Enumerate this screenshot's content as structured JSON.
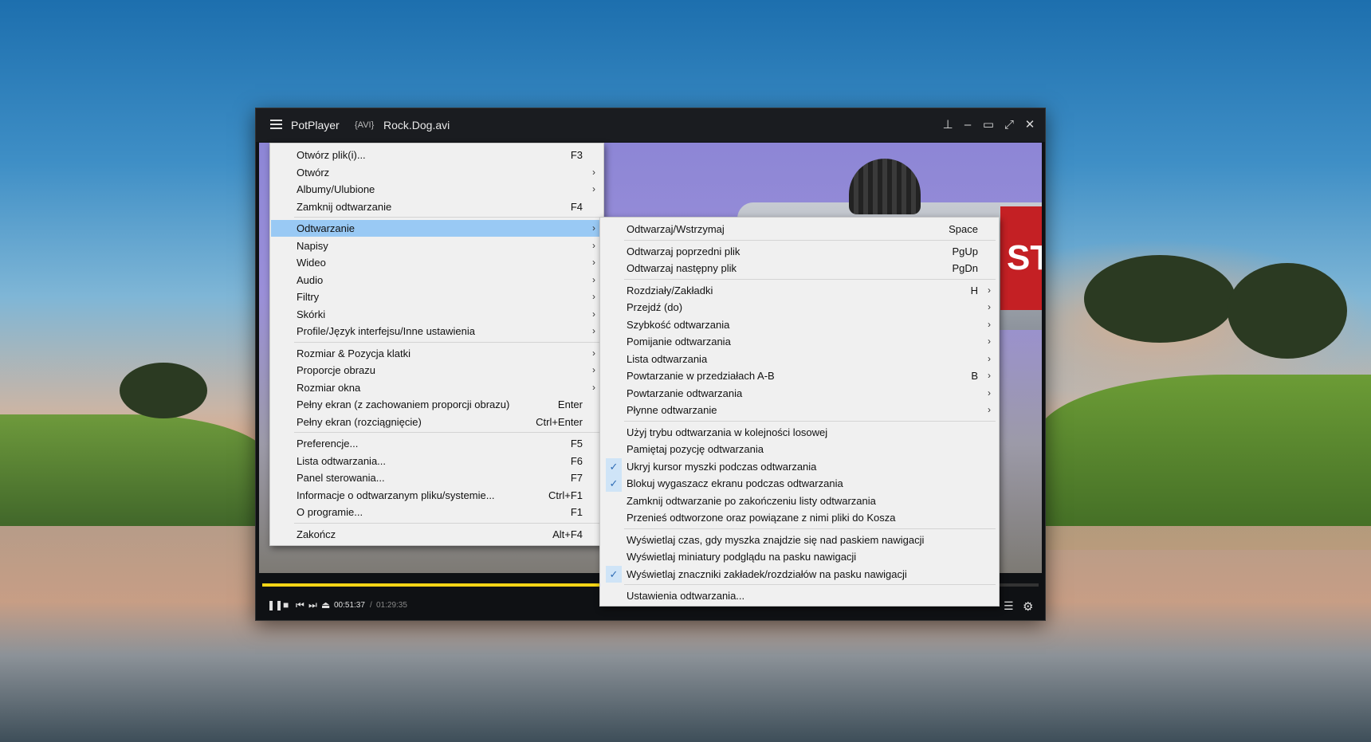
{
  "window": {
    "app_title": "PotPlayer",
    "format_tag": "{AVI}",
    "file_name": "Rock.Dog.avi"
  },
  "video_text": {
    "stop": "STO"
  },
  "playback": {
    "time_current": "00:51:37",
    "time_separator": "/",
    "time_total": "01:29:35",
    "progress_fraction": 0.576
  },
  "main_menu": {
    "items": [
      {
        "label": "Otwórz plik(i)...",
        "shortcut": "F3",
        "submenu": false
      },
      {
        "label": "Otwórz",
        "shortcut": "",
        "submenu": true
      },
      {
        "label": "Albumy/Ulubione",
        "shortcut": "",
        "submenu": true
      },
      {
        "label": "Zamknij odtwarzanie",
        "shortcut": "F4",
        "submenu": false
      },
      {
        "label": "Odtwarzanie",
        "shortcut": "",
        "submenu": true,
        "active": true
      },
      {
        "label": "Napisy",
        "shortcut": "",
        "submenu": true
      },
      {
        "label": "Wideo",
        "shortcut": "",
        "submenu": true
      },
      {
        "label": "Audio",
        "shortcut": "",
        "submenu": true
      },
      {
        "label": "Filtry",
        "shortcut": "",
        "submenu": true
      },
      {
        "label": "Skórki",
        "shortcut": "",
        "submenu": true
      },
      {
        "label": "Profile/Język interfejsu/Inne ustawienia",
        "shortcut": "",
        "submenu": true
      },
      {
        "label": "Rozmiar & Pozycja klatki",
        "shortcut": "",
        "submenu": true
      },
      {
        "label": "Proporcje obrazu",
        "shortcut": "",
        "submenu": true
      },
      {
        "label": "Rozmiar okna",
        "shortcut": "",
        "submenu": true
      },
      {
        "label": "Pełny ekran (z zachowaniem proporcji obrazu)",
        "shortcut": "Enter",
        "submenu": false
      },
      {
        "label": "Pełny ekran (rozciągnięcie)",
        "shortcut": "Ctrl+Enter",
        "submenu": false
      },
      {
        "label": "Preferencje...",
        "shortcut": "F5",
        "submenu": false
      },
      {
        "label": "Lista odtwarzania...",
        "shortcut": "F6",
        "submenu": false
      },
      {
        "label": "Panel sterowania...",
        "shortcut": "F7",
        "submenu": false
      },
      {
        "label": "Informacje o odtwarzanym pliku/systemie...",
        "shortcut": "Ctrl+F1",
        "submenu": false
      },
      {
        "label": "O programie...",
        "shortcut": "F1",
        "submenu": false
      },
      {
        "label": "Zakończ",
        "shortcut": "Alt+F4",
        "submenu": false
      }
    ]
  },
  "sub_menu": {
    "items": [
      {
        "label": "Odtwarzaj/Wstrzymaj",
        "shortcut": "Space",
        "submenu": false,
        "checked": false
      },
      {
        "label": "Odtwarzaj poprzedni plik",
        "shortcut": "PgUp",
        "submenu": false,
        "checked": false
      },
      {
        "label": "Odtwarzaj następny plik",
        "shortcut": "PgDn",
        "submenu": false,
        "checked": false
      },
      {
        "label": "Rozdziały/Zakładki",
        "shortcut": "H",
        "submenu": true,
        "checked": false
      },
      {
        "label": "Przejdź (do)",
        "shortcut": "",
        "submenu": true,
        "checked": false
      },
      {
        "label": "Szybkość odtwarzania",
        "shortcut": "",
        "submenu": true,
        "checked": false
      },
      {
        "label": "Pomijanie odtwarzania",
        "shortcut": "",
        "submenu": true,
        "checked": false
      },
      {
        "label": "Lista odtwarzania",
        "shortcut": "",
        "submenu": true,
        "checked": false
      },
      {
        "label": "Powtarzanie w przedziałach A-B",
        "shortcut": "B",
        "submenu": true,
        "checked": false
      },
      {
        "label": "Powtarzanie odtwarzania",
        "shortcut": "",
        "submenu": true,
        "checked": false
      },
      {
        "label": "Płynne odtwarzanie",
        "shortcut": "",
        "submenu": true,
        "checked": false
      },
      {
        "label": "Użyj trybu odtwarzania w kolejności losowej",
        "shortcut": "",
        "submenu": false,
        "checked": false
      },
      {
        "label": "Pamiętaj pozycję odtwarzania",
        "shortcut": "",
        "submenu": false,
        "checked": false
      },
      {
        "label": "Ukryj kursor myszki podczas odtwarzania",
        "shortcut": "",
        "submenu": false,
        "checked": true
      },
      {
        "label": "Blokuj wygaszacz ekranu podczas odtwarzania",
        "shortcut": "",
        "submenu": false,
        "checked": true
      },
      {
        "label": "Zamknij odtwarzanie po zakończeniu listy odtwarzania",
        "shortcut": "",
        "submenu": false,
        "checked": false
      },
      {
        "label": "Przenieś odtworzone oraz powiązane z nimi pliki do Kosza",
        "shortcut": "",
        "submenu": false,
        "checked": false
      },
      {
        "label": "Wyświetlaj czas, gdy myszka znajdzie się nad paskiem nawigacji",
        "shortcut": "",
        "submenu": false,
        "checked": false
      },
      {
        "label": "Wyświetlaj miniatury podglądu na pasku nawigacji",
        "shortcut": "",
        "submenu": false,
        "checked": false
      },
      {
        "label": "Wyświetlaj znaczniki zakładek/rozdziałów na pasku nawigacji",
        "shortcut": "",
        "submenu": false,
        "checked": true
      },
      {
        "label": "Ustawienia odtwarzania...",
        "shortcut": "",
        "submenu": false,
        "checked": false
      }
    ]
  },
  "icons": {
    "arrow": "›",
    "check": "✓"
  },
  "colors": {
    "progress": "#f3d416",
    "menu_highlight": "#99c9f4"
  }
}
